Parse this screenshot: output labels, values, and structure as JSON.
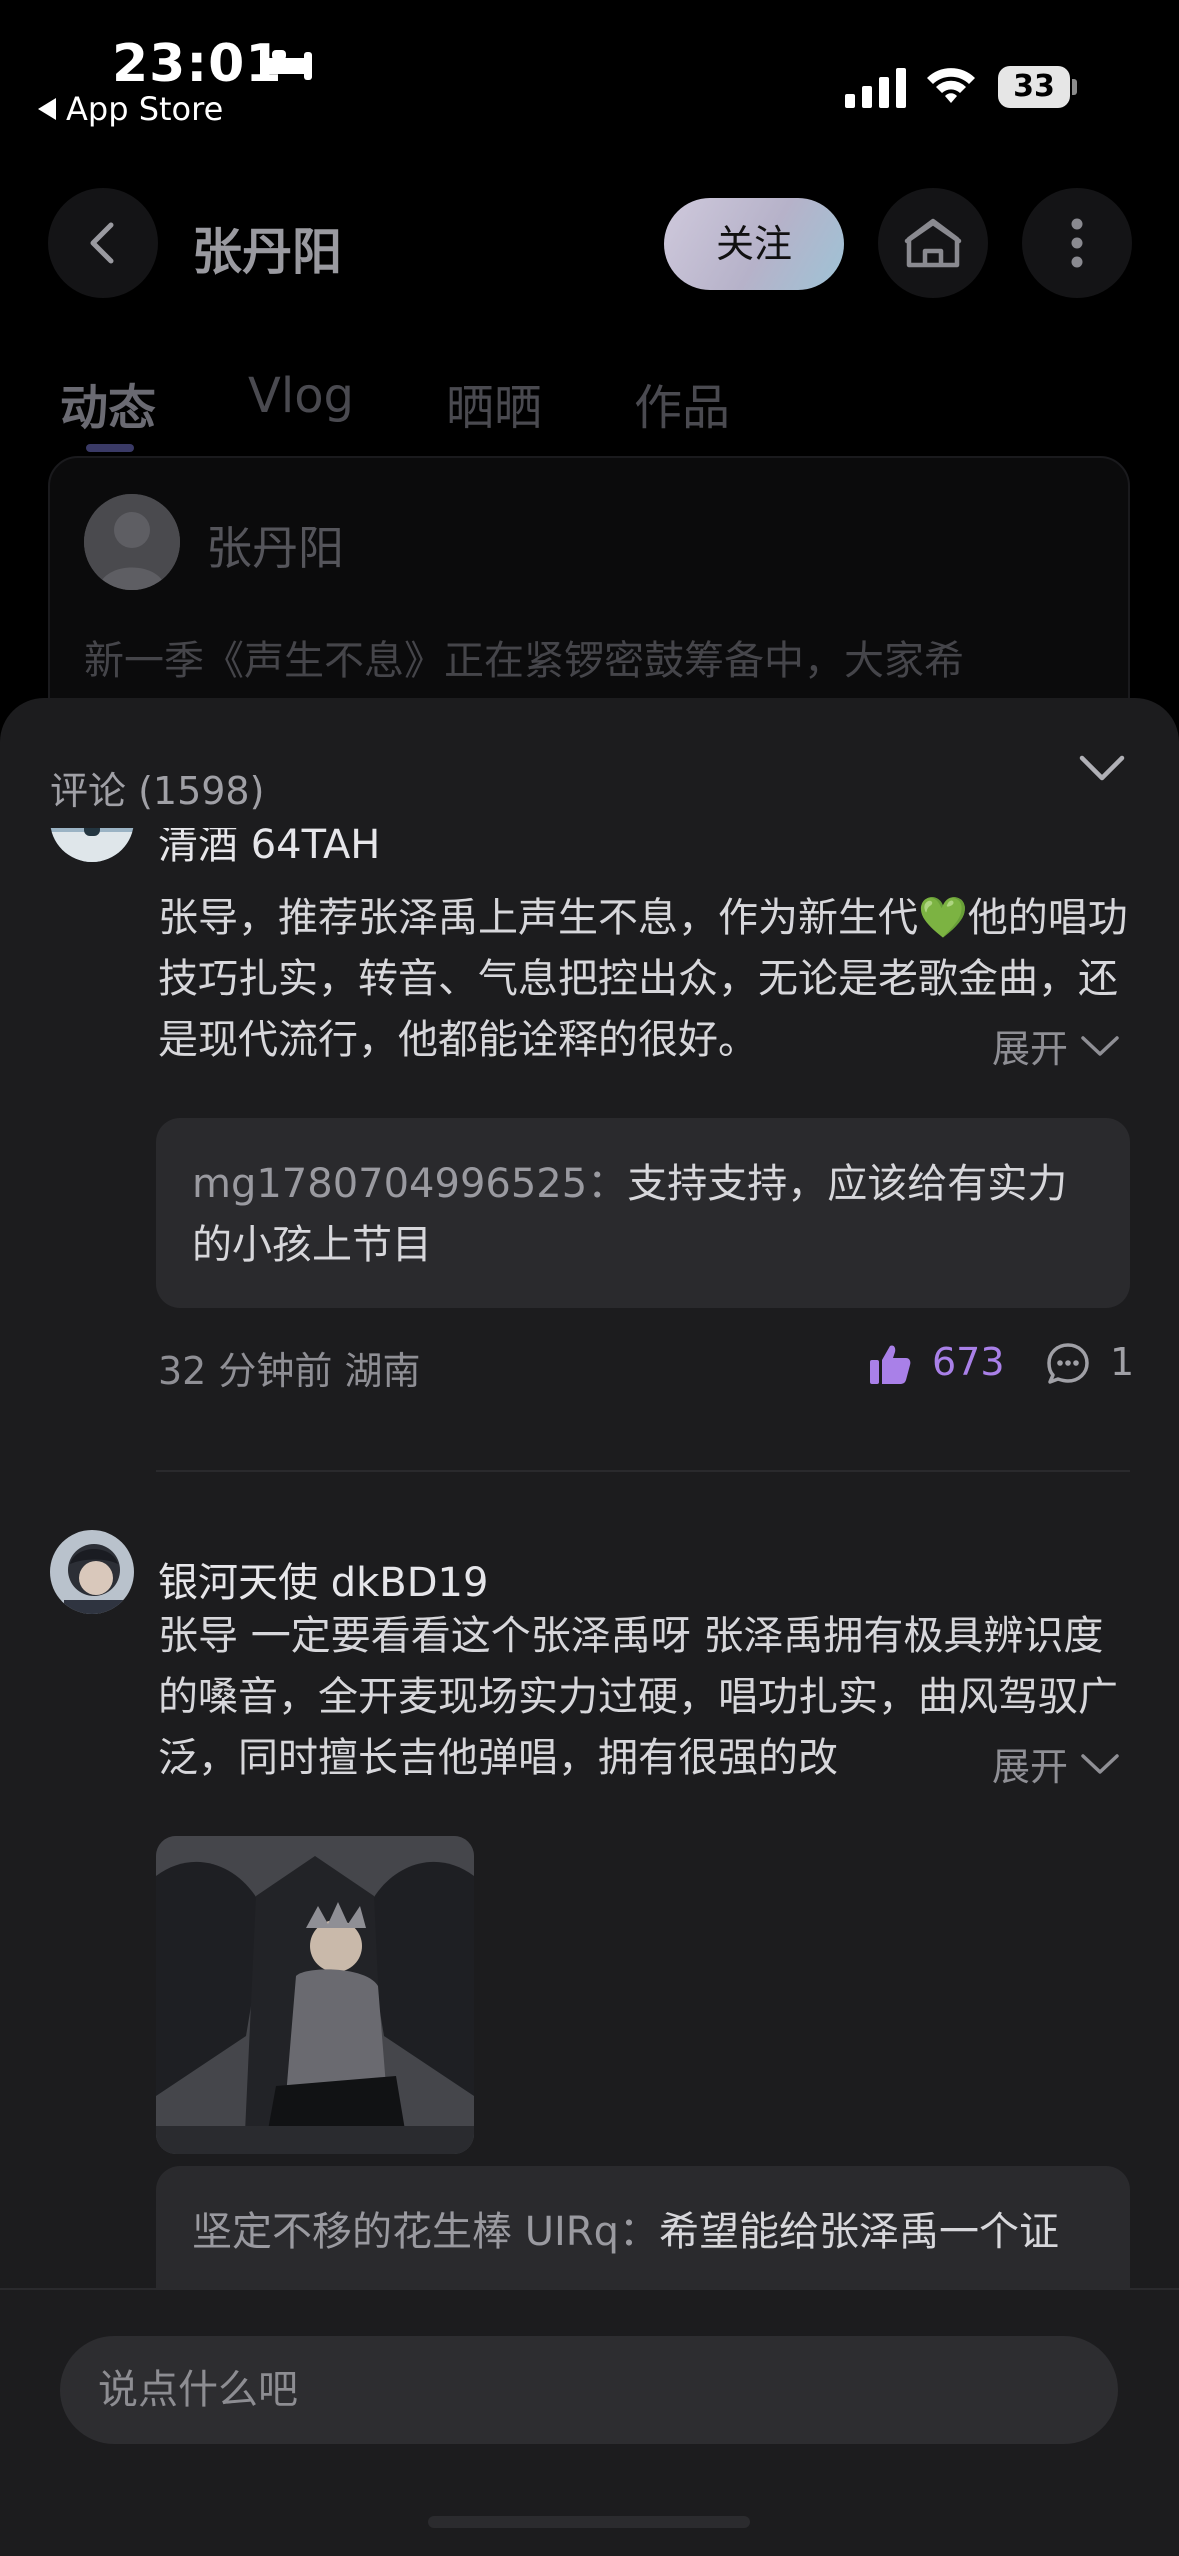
{
  "status_bar": {
    "time": "23:01",
    "back_app": "App Store",
    "battery": "33"
  },
  "header": {
    "title": "张丹阳",
    "follow_label": "关注"
  },
  "tabs": [
    "动态",
    "Vlog",
    "晒晒",
    "作品"
  ],
  "post": {
    "author": "张丹阳",
    "text": "新一季《声生不息》正在紧锣密鼓筹备中，大家希"
  },
  "sheet": {
    "title": "评论 (1598)"
  },
  "comments": [
    {
      "user": "清酒 64TAH",
      "text": "张导，推荐张泽禹上声生不息，作为新生代💚他的唱功技巧扎实，转音、气息把控出众，无论是老歌金曲，还是现代流行，他都能诠释的很好。",
      "expand_label": "展开",
      "reply_user": "mg1780704996525：",
      "reply_text": "支持支持，应该给有实力的小孩上节目",
      "meta": "32 分钟前  湖南",
      "likes": "673",
      "replies": "1"
    },
    {
      "user": "银河天使 dkBD19",
      "text": "张导 一定要看看这个张泽禹呀 张泽禹拥有极具辨识度的嗓音，全开麦现场实力过硬，唱功扎实，曲风驾驭广泛，同时擅长吉他弹唱，拥有很强的改",
      "expand_label": "展开",
      "reply_user": "坚定不移的花生棒 UIRq：",
      "reply_text": "希望能给张泽禹一个证"
    }
  ],
  "input": {
    "placeholder": "说点什么吧"
  }
}
